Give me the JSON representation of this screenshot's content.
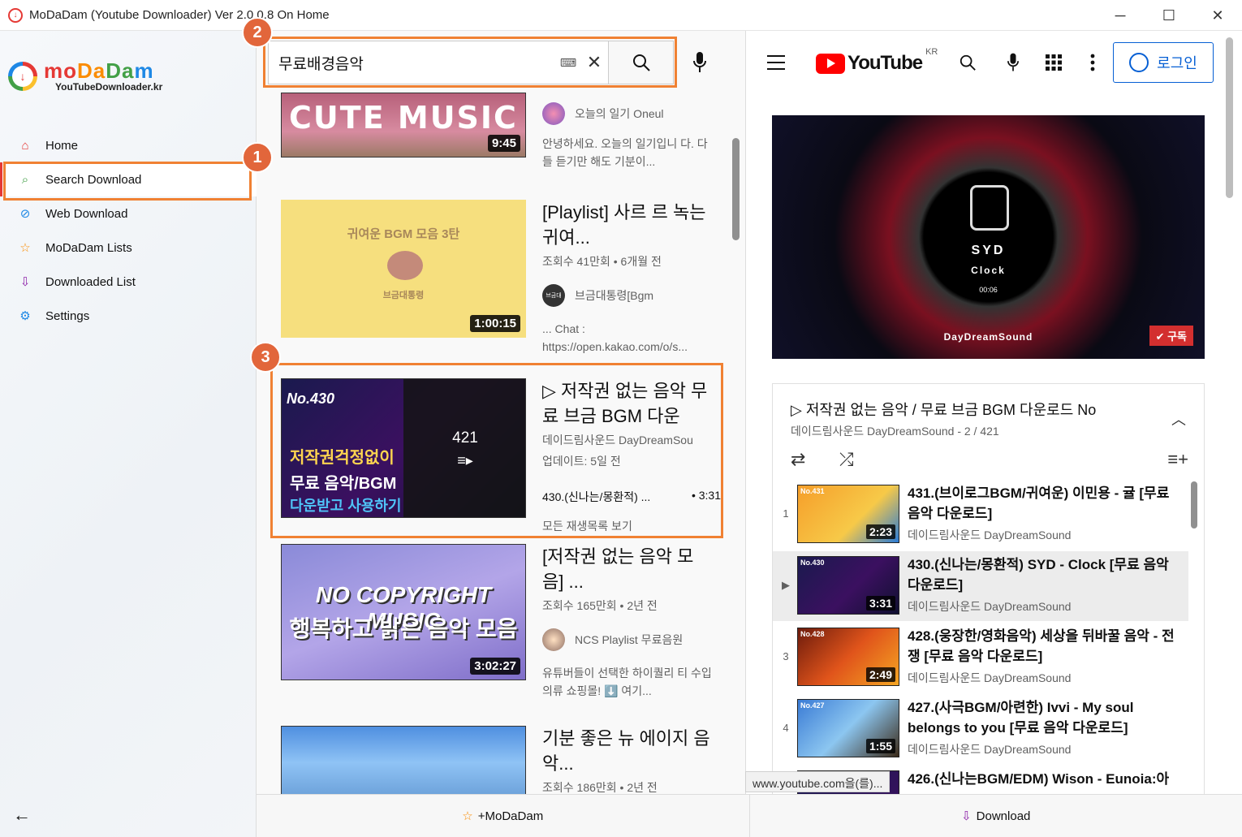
{
  "window": {
    "title": "MoDaDam (Youtube Downloader) Ver 2.0.0.8 On Home",
    "minimize": "─",
    "maximize": "☐",
    "close": "✕"
  },
  "logo": {
    "m": "mo",
    "d": "Da",
    "d2": "Da",
    "m2": "m",
    "subtitle": "YouTubeDownloader.kr"
  },
  "sidebar": {
    "items": [
      {
        "label": "Home",
        "icon": "home-icon",
        "glyph": "⌂"
      },
      {
        "label": "Search Download",
        "icon": "search-icon",
        "glyph": "⌕"
      },
      {
        "label": "Web Download",
        "icon": "globe-icon",
        "glyph": "⊘"
      },
      {
        "label": "MoDaDam Lists",
        "icon": "star-icon",
        "glyph": "☆"
      },
      {
        "label": "Downloaded List",
        "icon": "download-tray-icon",
        "glyph": "⇩"
      },
      {
        "label": "Settings",
        "icon": "gear-icon",
        "glyph": "⚙"
      }
    ],
    "back": "←"
  },
  "callouts": {
    "one": "1",
    "two": "2",
    "three": "3"
  },
  "search": {
    "query": "무료배경음악",
    "keyboard": "⌨",
    "clear": "✕"
  },
  "results": [
    {
      "thumb_text": "CUTE MUSIC",
      "duration": "9:45",
      "channel": "오늘의 일기 Oneul",
      "desc": "안녕하세요. 오늘의 일기입니 다. 다들 듣기만 해도 기분이..."
    },
    {
      "thumb_text": "귀여운 BGM 모음 3탄",
      "thumb_sub": "브금대통령",
      "duration": "1:00:15",
      "title": "[Playlist] 사르 르 녹는 귀여...",
      "meta": "조회수 41만회 • 6개월 전",
      "channel": "브금대통령[Bgm",
      "channel_avatar": "브금대",
      "desc": "... Chat : https://open.kakao.com/o/s..."
    },
    {
      "thumb_text1": "No.430",
      "thumb_text2": "저작권걱정없이",
      "thumb_text3": "무료 음악/BGM",
      "thumb_text4": "다운받고 사용하기",
      "count": "421",
      "title": "▷ 저작권 없는 음악 무료 브금 BGM 다운",
      "meta1": "데이드림사운드 DayDreamSou",
      "meta2": "업데이트: 5일 전",
      "track": "430.(신나는/몽환적) ...",
      "track_time": "• 3:31",
      "view_all": "모든 재생목록 보기"
    },
    {
      "thumb_text": "NO COPYRIGHT MUSIC",
      "thumb_sub": "행복하고 밝은 음악 모음",
      "duration": "3:02:27",
      "title": "[저작권 없는 음악 모음] ...",
      "meta": "조회수 165만회 • 2년 전",
      "channel": "NCS Playlist 무료음원",
      "desc": "유튜버들이 선택한 하이퀄리 티 수입의류 쇼핑몰! ⬇️ 여기..."
    },
    {
      "title": "기분 좋은 뉴 에이지 음악...",
      "meta": "조회수 186만회 • 2년 전"
    }
  ],
  "youtube": {
    "logo_word": "YouTube",
    "region": "KR",
    "login": "로그인",
    "video": {
      "title": "SYD",
      "subtitle": "Clock",
      "time": "00:06",
      "brand": "DayDreamSound",
      "subscribe": "✔ 구독"
    },
    "playlist": {
      "title": "▷ 저작권 없는 음악 / 무료 브금 BGM 다운로드 No",
      "sub": "데이드림사운드 DayDreamSound - 2 / 421",
      "items": [
        {
          "idx": "1",
          "no": "No.431",
          "dur": "2:23",
          "title": "431.(브이로그BGM/귀여운) 이민용 - 귤 [무료 음악 다운로드]",
          "channel": "데이드림사운드 DayDreamSound"
        },
        {
          "idx": "▶",
          "no": "No.430",
          "dur": "3:31",
          "title": "430.(신나는/몽환적) SYD - Clock [무료 음악 다운로드]",
          "channel": "데이드림사운드 DayDreamSound"
        },
        {
          "idx": "3",
          "no": "No.428",
          "dur": "2:49",
          "title": "428.(웅장한/영화음악) 세상을 뒤바꿀 음악 - 전쟁 [무료 음악 다운로드]",
          "channel": "데이드림사운드 DayDreamSound"
        },
        {
          "idx": "4",
          "no": "No.427",
          "dur": "1:55",
          "title": "427.(사극BGM/아련한) Ivvi - My soul belongs to you [무료 음악 다운로드]",
          "channel": "데이드림사운드 DayDreamSound"
        },
        {
          "idx": "",
          "no": "",
          "dur": "",
          "title": "426.(신나는BGM/EDM) Wison - Eunoia:아",
          "channel": ""
        }
      ]
    },
    "url_tip": "www.youtube.com을(를)..."
  },
  "bottom": {
    "add": "+MoDaDam",
    "download": "Download"
  },
  "colors": {
    "accent": "#f08133",
    "badge": "#e2663b",
    "yt_red": "#ff0000",
    "login_blue": "#065fd4"
  }
}
